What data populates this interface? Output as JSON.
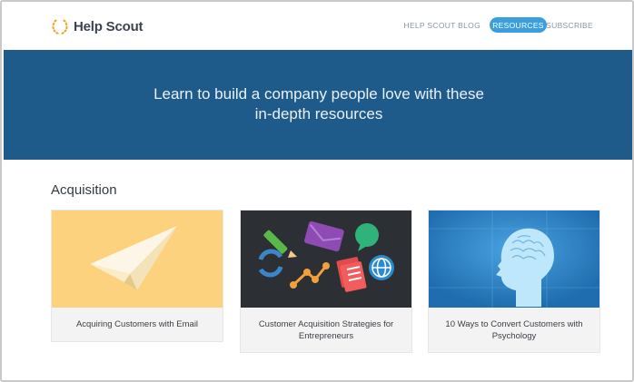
{
  "header": {
    "logo_text": "Help Scout",
    "nav": {
      "blog": "HELP SCOUT BLOG",
      "resources": "RESOURCES",
      "subscribe": "SUBSCRIBE"
    }
  },
  "hero": {
    "line_1": "Learn to build a company people love with these",
    "line_2": "in-depth resources"
  },
  "section": {
    "title": "Acquisition"
  },
  "cards": [
    {
      "title_1": "Acquiring Customers with Email",
      "title_2": "",
      "image": "paper-plane-illustration"
    },
    {
      "title_1": "Customer Acquisition Strategies for",
      "title_2": "Entrepreneurs",
      "image": "marketing-icons-illustration"
    },
    {
      "title_1": "10 Ways to Convert Customers with",
      "title_2": "Psychology",
      "image": "brain-head-illustration"
    }
  ],
  "colors": {
    "hero_bg": "#1e5a8a",
    "nav_active_bg": "#3b9ede",
    "logo_accent": "#f0a626",
    "card_1_bg": "#fcd27e",
    "card_2_bg": "#2c2f33",
    "card_3_bg": "#1f6dae"
  }
}
